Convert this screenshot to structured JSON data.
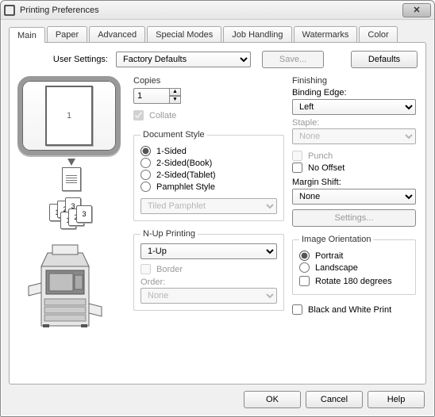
{
  "window": {
    "title": "Printing Preferences",
    "close_glyph": "✕"
  },
  "tabs": [
    "Main",
    "Paper",
    "Advanced",
    "Special Modes",
    "Job Handling",
    "Watermarks",
    "Color"
  ],
  "top": {
    "user_settings_label": "User Settings:",
    "user_settings_value": "Factory Defaults",
    "save_label": "Save...",
    "defaults_label": "Defaults"
  },
  "copies": {
    "label": "Copies",
    "value": "1",
    "collate_label": "Collate"
  },
  "doc_style": {
    "legend": "Document Style",
    "opt1": "1-Sided",
    "opt2": "2-Sided(Book)",
    "opt3": "2-Sided(Tablet)",
    "opt4": "Pamphlet Style",
    "pamphlet_select": "Tiled Pamphlet"
  },
  "nup": {
    "legend": "N-Up Printing",
    "value": "1-Up",
    "border_label": "Border",
    "order_label": "Order:",
    "order_value": "None"
  },
  "finishing": {
    "label": "Finishing",
    "binding_edge_label": "Binding Edge:",
    "binding_edge_value": "Left",
    "staple_label": "Staple:",
    "staple_value": "None",
    "punch_label": "Punch",
    "no_offset_label": "No Offset",
    "margin_shift_label": "Margin Shift:",
    "margin_shift_value": "None",
    "settings_label": "Settings..."
  },
  "image_orient": {
    "legend": "Image Orientation",
    "portrait": "Portrait",
    "landscape": "Landscape",
    "rotate": "Rotate 180 degrees"
  },
  "bw": {
    "label": "Black and White Print"
  },
  "preview": {
    "page_number": "1"
  },
  "footer": {
    "ok": "OK",
    "cancel": "Cancel",
    "help": "Help"
  }
}
